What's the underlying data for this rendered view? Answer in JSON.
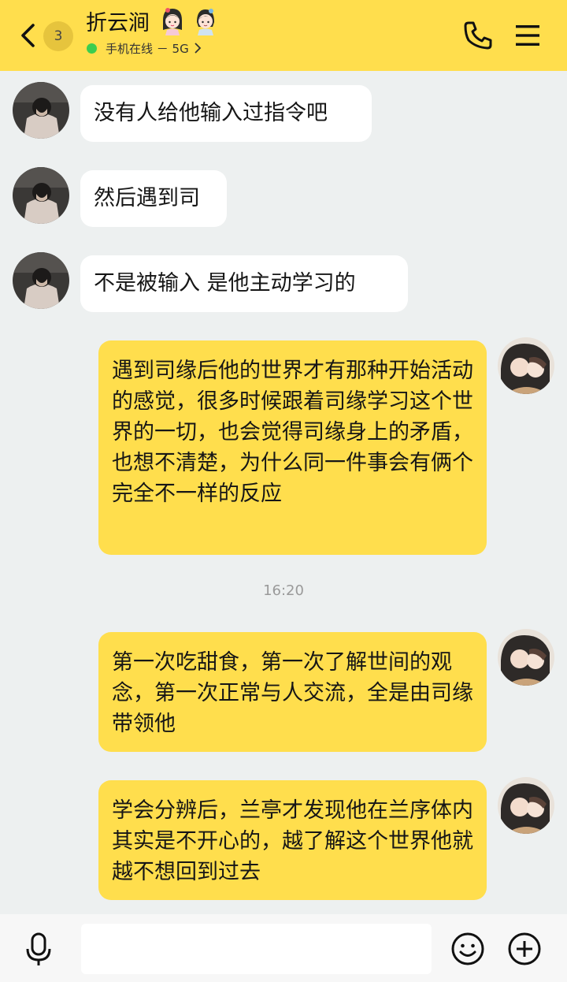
{
  "header": {
    "unread_count": "3",
    "title": "折云涧",
    "status_text": "手机在线 － 5G"
  },
  "messages": [
    {
      "side": "in",
      "text": "没有人给他输入过指令吧"
    },
    {
      "side": "in",
      "text": "然后遇到司"
    },
    {
      "side": "in",
      "text": "不是被输入 是他主动学习的"
    },
    {
      "side": "out",
      "text": "遇到司缘后他的世界才有那种开始活动的感觉，很多时候跟着司缘学习这个世界的一切，也会觉得司缘身上的矛盾，也想不清楚，为什么同一件事会有俩个完全不一样的反应"
    },
    {
      "side": "out",
      "text": "第一次吃甜食，第一次了解世间的观念，第一次正常与人交流，全是由司缘带领他"
    },
    {
      "side": "out",
      "text": "学会分辨后，兰亭才发现他在兰序体内其实是不开心的，越了解这个世界他就越不想回到过去"
    }
  ],
  "timestamp": "16:20",
  "footer": {
    "input_value": "",
    "input_placeholder": ""
  },
  "colors": {
    "accent_yellow": "#ffde4d",
    "background": "#edf0f0",
    "online_green": "#3ccd4f"
  },
  "icons": {
    "back": "chevron-left-icon",
    "call": "phone-icon",
    "menu": "hamburger-menu-icon",
    "voice": "microphone-icon",
    "emoji": "smiley-icon",
    "more": "plus-circle-icon"
  }
}
